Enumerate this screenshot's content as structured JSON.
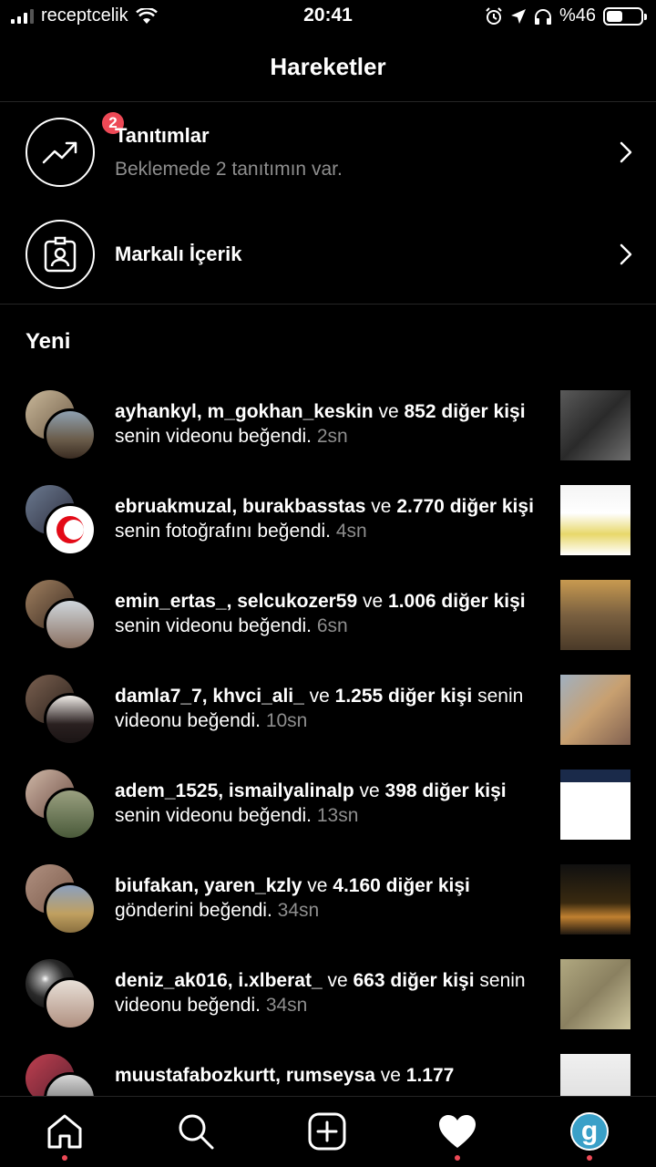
{
  "status_bar": {
    "carrier": "receptcelik",
    "time": "20:41",
    "battery": "%46",
    "battery_level": 0.46
  },
  "header": {
    "title": "Hareketler"
  },
  "promotions": {
    "title": "Tanıtımlar",
    "subtitle": "Beklemede 2 tanıtımın var.",
    "badge": "2"
  },
  "branded": {
    "title": "Markalı İçerik"
  },
  "section": {
    "title": "Yeni"
  },
  "activities": [
    {
      "users": "ayhankyl, m_gokhan_keskin",
      "connector": " ve ",
      "count": "852 diğer kişi",
      "action": " senin videonu beğendi. ",
      "time": "2sn"
    },
    {
      "users": "ebruakmuzal, burakbasstas",
      "connector": " ve ",
      "count": "2.770 diğer kişi",
      "action": " senin fotoğrafını beğendi. ",
      "time": "4sn"
    },
    {
      "users": "emin_ertas_, selcukozer59",
      "connector": " ve ",
      "count": "1.006 diğer kişi",
      "action": " senin videonu beğendi. ",
      "time": "6sn"
    },
    {
      "users": "damla7_7, khvci_ali_",
      "connector": " ve ",
      "count": "1.255 diğer kişi",
      "action": " senin videonu beğendi. ",
      "time": "10sn"
    },
    {
      "users": "adem_1525, ismailyalinalp",
      "connector": " ve ",
      "count": "398 diğer kişi",
      "action": " senin videonu beğendi. ",
      "time": "13sn"
    },
    {
      "users": "biufakan, yaren_kzly",
      "connector": " ve ",
      "count": "4.160 diğer kişi",
      "action": " gönderini beğendi. ",
      "time": "34sn"
    },
    {
      "users": "deniz_ak016, i.xlberat_",
      "connector": " ve ",
      "count": "663 diğer kişi",
      "action": " senin videonu beğendi. ",
      "time": "34sn"
    },
    {
      "users": "muustafabozkurtt, rumseysa",
      "connector": " ve ",
      "count": "1.177",
      "action": "",
      "time": ""
    }
  ],
  "nav": {
    "home": "home-icon",
    "search": "search-icon",
    "add": "add-icon",
    "activity": "heart-icon",
    "profile_letter": "g"
  },
  "colors": {
    "badge": "#ed4956",
    "muted": "#8e8e8e",
    "background": "#000000"
  }
}
